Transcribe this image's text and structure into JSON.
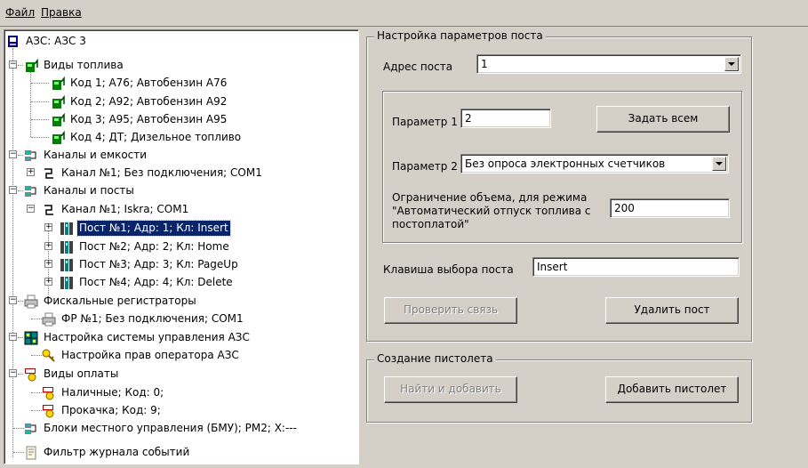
{
  "menu": {
    "file": "Файл",
    "edit": "Правка"
  },
  "tree": {
    "root": "АЗС: АЗС 3",
    "fuel_types": "Виды топлива",
    "fuel_1": "Код 1; А76; Автобензин А76",
    "fuel_2": "Код 2; А92; Автобензин А92",
    "fuel_3": "Код 3; А95; Автобензин А95",
    "fuel_4": "Код 4; ДТ; Дизельное топливо",
    "channels_tanks": "Каналы и емкости",
    "channel_tank_1": "Канал №1; Без подключения; COM1",
    "channels_posts": "Каналы и посты",
    "channel_post_1": "Канал №1; Iskra; COM1",
    "post_1": "Пост №1; Адр: 1; Кл: Insert",
    "post_2": "Пост №2; Адр: 2; Кл: Home",
    "post_3": "Пост №3; Адр: 3; Кл: PageUp",
    "post_4": "Пост №4; Адр: 4; Кл: Delete",
    "fiscal": "Фискальные регистраторы",
    "fiscal_1": "ФР №1; Без подключения; COM1",
    "system": "Настройка системы управления АЗС",
    "system_rights": "Настройка прав оператора АЗС",
    "payments": "Виды оплаты",
    "pay_cash": "Наличные; Код: 0;",
    "pay_pump": "Прокачка; Код: 9;",
    "bmu": "Блоки местного управления (БМУ);  PM2;  X:---",
    "log_filter": "Фильтр журнала событий"
  },
  "post_settings": {
    "title": "Настройка параметров поста",
    "address_label": "Адрес поста",
    "address_value": "1",
    "param1_label": "Параметр 1",
    "param1_value": "2",
    "set_all_button": "Задать всем",
    "param2_label": "Параметр 2",
    "param2_value": "Без опроса электронных счетчиков",
    "limit_label_1": "Ограничение объема, для режима",
    "limit_label_2": "\"Автоматический отпуск топлива с",
    "limit_label_3": "постоплатой\"",
    "limit_value": "200",
    "key_label": "Клавиша выбора поста",
    "key_value": "Insert",
    "check_button": "Проверить связь",
    "delete_button": "Удалить пост"
  },
  "pistol": {
    "title": "Создание пистолета",
    "find_button": "Найти и добавить",
    "add_button": "Добавить пистолет"
  },
  "colors": {
    "selection": "#0a246a",
    "face": "#d4d0c8",
    "fuel_green": "#008000"
  }
}
